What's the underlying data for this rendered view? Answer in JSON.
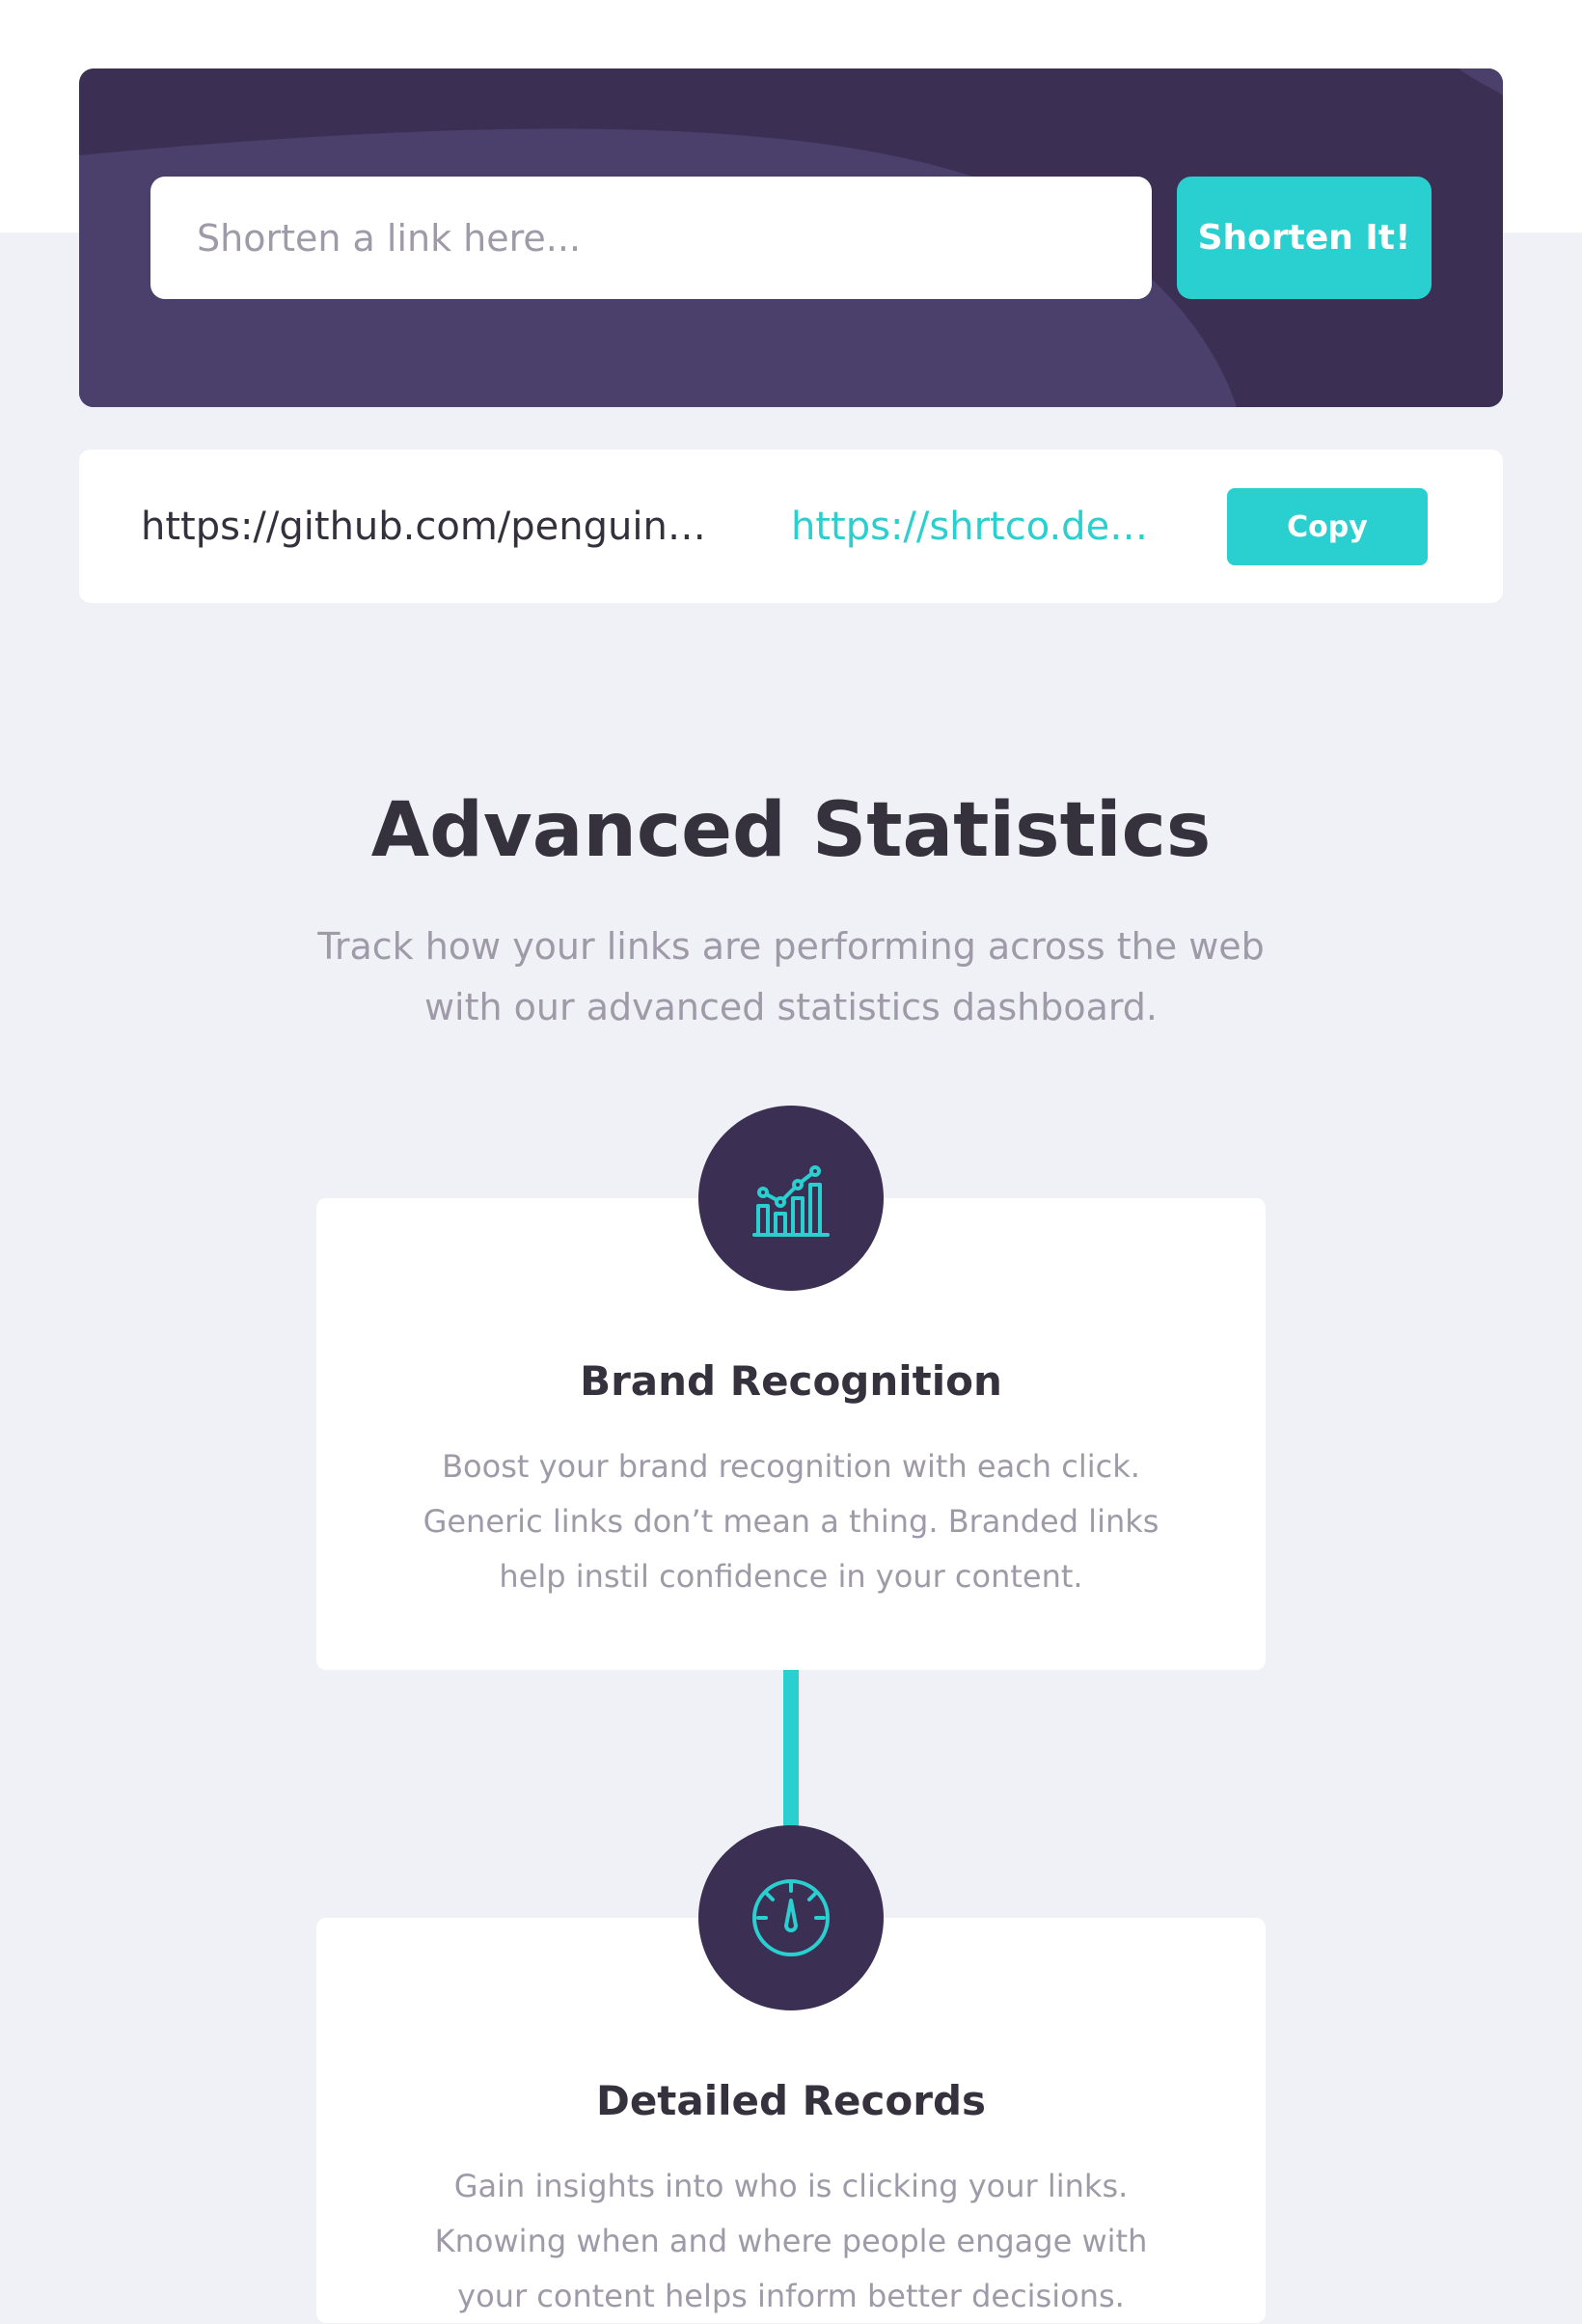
{
  "shorten": {
    "placeholder": "Shorten a link here...",
    "button_label": "Shorten It!"
  },
  "result": {
    "original_url": "https://github.com/penguin…",
    "short_url": "https://shrtco.de…",
    "copy_label": "Copy"
  },
  "stats": {
    "title": "Advanced Statistics",
    "subtitle": "Track how your links are performing across the web with our advanced statistics dashboard."
  },
  "features": [
    {
      "icon": "chart-icon",
      "title": "Brand Recognition",
      "body": "Boost your brand recognition with each click. Generic links don’t mean a thing. Branded links help instil confidence in your content."
    },
    {
      "icon": "gauge-icon",
      "title": "Detailed Records",
      "body": "Gain insights into who is clicking your links. Knowing when and where people engage with your content helps inform better decisions."
    }
  ],
  "colors": {
    "accent": "#2acfcf",
    "dark_violet": "#3b3054",
    "heading": "#35323e",
    "muted": "#9e9aa8",
    "background": "#f0f1f6"
  }
}
